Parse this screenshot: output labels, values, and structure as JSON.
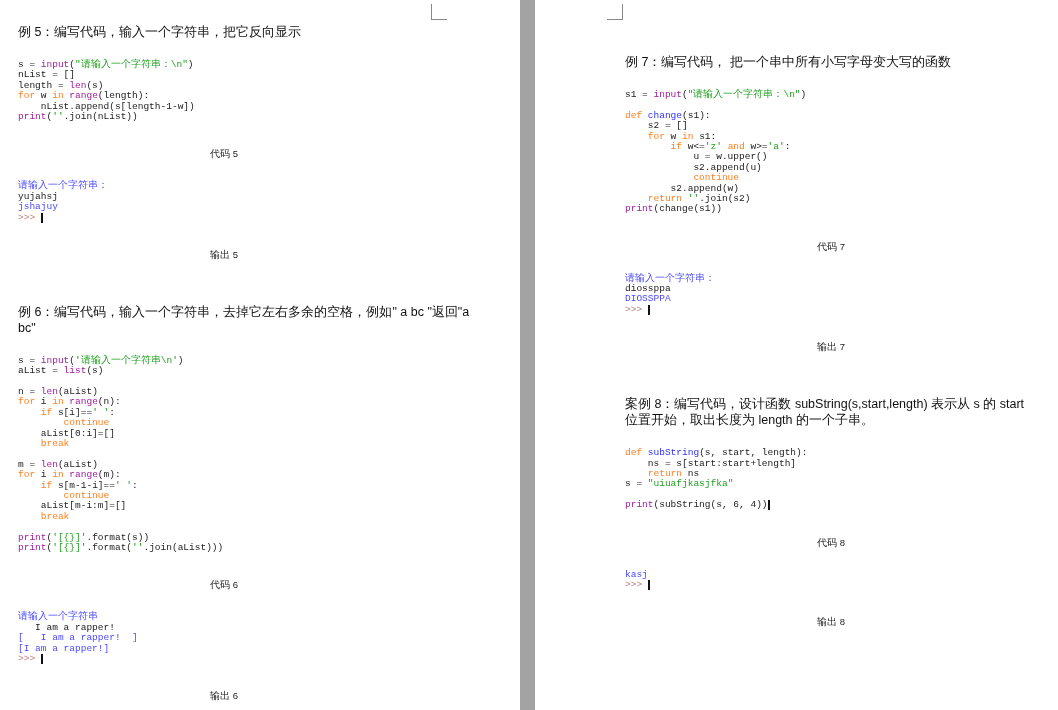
{
  "pages": [
    {
      "sections": [
        {
          "heading": "例 5：编写代码，输入一个字符串，把它反向显示",
          "code": [
            {
              "kind": "text",
              "tokens": [
                {
                  "kind": "plain",
                  "text": "s = "
                },
                {
                  "kind": "builtin",
                  "text": "input"
                },
                {
                  "kind": "plain",
                  "text": "("
                },
                {
                  "kind": "string",
                  "text": "\"请输入一个字符串：\\n\""
                },
                {
                  "kind": "plain",
                  "text": ")"
                }
              ]
            },
            {
              "kind": "text",
              "tokens": [
                {
                  "kind": "plain",
                  "text": "nList = []"
                }
              ]
            },
            {
              "kind": "text",
              "tokens": [
                {
                  "kind": "plain",
                  "text": "length = "
                },
                {
                  "kind": "builtin",
                  "text": "len"
                },
                {
                  "kind": "plain",
                  "text": "(s)"
                }
              ]
            },
            {
              "kind": "text",
              "tokens": [
                {
                  "kind": "keyword",
                  "text": "for"
                },
                {
                  "kind": "plain",
                  "text": " w "
                },
                {
                  "kind": "keyword",
                  "text": "in "
                },
                {
                  "kind": "builtin",
                  "text": "range"
                },
                {
                  "kind": "plain",
                  "text": "(length):"
                }
              ]
            },
            {
              "kind": "text",
              "tokens": [
                {
                  "kind": "plain",
                  "text": "    nList.append(s[length-1-w])"
                }
              ]
            },
            {
              "kind": "text",
              "tokens": [
                {
                  "kind": "builtin",
                  "text": "print"
                },
                {
                  "kind": "plain",
                  "text": "("
                },
                {
                  "kind": "string",
                  "text": "''"
                },
                {
                  "kind": "plain",
                  "text": ".join(nList))"
                }
              ]
            }
          ],
          "code_caption": "代码 5",
          "output": [
            {
              "kind": "text",
              "tokens": [
                {
                  "kind": "output",
                  "text": "请输入一个字符串："
                }
              ]
            },
            {
              "kind": "text",
              "tokens": [
                {
                  "kind": "plain",
                  "text": "yujahsj"
                }
              ]
            },
            {
              "kind": "text",
              "tokens": [
                {
                  "kind": "output",
                  "text": "jshajuy"
                }
              ]
            },
            {
              "kind": "text",
              "tokens": [
                {
                  "kind": "prompt",
                  "text": ">>> "
                }
              ],
              "cursor": true
            }
          ],
          "output_caption": "输出 5"
        },
        {
          "heading": "例 6：编写代码，输入一个字符串，去掉它左右多余的空格，例如\" a bc \"返回\"a bc\"",
          "code": [
            {
              "kind": "text",
              "tokens": [
                {
                  "kind": "plain",
                  "text": "s = "
                },
                {
                  "kind": "builtin",
                  "text": "input"
                },
                {
                  "kind": "plain",
                  "text": "("
                },
                {
                  "kind": "string",
                  "text": "'请输入一个字符串\\n'"
                },
                {
                  "kind": "plain",
                  "text": ")"
                }
              ]
            },
            {
              "kind": "text",
              "tokens": [
                {
                  "kind": "plain",
                  "text": "aList = "
                },
                {
                  "kind": "builtin",
                  "text": "list"
                },
                {
                  "kind": "plain",
                  "text": "(s)"
                }
              ]
            },
            {
              "kind": "blank"
            },
            {
              "kind": "text",
              "tokens": [
                {
                  "kind": "plain",
                  "text": "n = "
                },
                {
                  "kind": "builtin",
                  "text": "len"
                },
                {
                  "kind": "plain",
                  "text": "(aList)"
                }
              ]
            },
            {
              "kind": "text",
              "tokens": [
                {
                  "kind": "keyword",
                  "text": "for"
                },
                {
                  "kind": "plain",
                  "text": " i "
                },
                {
                  "kind": "keyword",
                  "text": "in "
                },
                {
                  "kind": "builtin",
                  "text": "range"
                },
                {
                  "kind": "plain",
                  "text": "(n):"
                }
              ]
            },
            {
              "kind": "text",
              "tokens": [
                {
                  "kind": "keyword",
                  "text": "    if"
                },
                {
                  "kind": "plain",
                  "text": " s[i]=="
                },
                {
                  "kind": "string",
                  "text": "' '"
                },
                {
                  "kind": "plain",
                  "text": ":"
                }
              ]
            },
            {
              "kind": "text",
              "tokens": [
                {
                  "kind": "keyword",
                  "text": "        continue"
                }
              ]
            },
            {
              "kind": "text",
              "tokens": [
                {
                  "kind": "plain",
                  "text": "    aList[0:i]=[]"
                }
              ]
            },
            {
              "kind": "text",
              "tokens": [
                {
                  "kind": "keyword",
                  "text": "    break"
                }
              ]
            },
            {
              "kind": "blank"
            },
            {
              "kind": "text",
              "tokens": [
                {
                  "kind": "plain",
                  "text": "m = "
                },
                {
                  "kind": "builtin",
                  "text": "len"
                },
                {
                  "kind": "plain",
                  "text": "(aList)"
                }
              ]
            },
            {
              "kind": "text",
              "tokens": [
                {
                  "kind": "keyword",
                  "text": "for"
                },
                {
                  "kind": "plain",
                  "text": " i "
                },
                {
                  "kind": "keyword",
                  "text": "in "
                },
                {
                  "kind": "builtin",
                  "text": "range"
                },
                {
                  "kind": "plain",
                  "text": "(m):"
                }
              ]
            },
            {
              "kind": "text",
              "tokens": [
                {
                  "kind": "keyword",
                  "text": "    if"
                },
                {
                  "kind": "plain",
                  "text": " s[m-1-i]=="
                },
                {
                  "kind": "string",
                  "text": "' '"
                },
                {
                  "kind": "plain",
                  "text": ":"
                }
              ]
            },
            {
              "kind": "text",
              "tokens": [
                {
                  "kind": "keyword",
                  "text": "        continue"
                }
              ]
            },
            {
              "kind": "text",
              "tokens": [
                {
                  "kind": "plain",
                  "text": "    aList[m-i:m]=[]"
                }
              ]
            },
            {
              "kind": "text",
              "tokens": [
                {
                  "kind": "keyword",
                  "text": "    break"
                }
              ]
            },
            {
              "kind": "blank"
            },
            {
              "kind": "text",
              "tokens": [
                {
                  "kind": "builtin",
                  "text": "print"
                },
                {
                  "kind": "plain",
                  "text": "("
                },
                {
                  "kind": "string",
                  "text": "'[{}]'"
                },
                {
                  "kind": "plain",
                  "text": ".format(s))"
                }
              ]
            },
            {
              "kind": "text",
              "tokens": [
                {
                  "kind": "builtin",
                  "text": "print"
                },
                {
                  "kind": "plain",
                  "text": "("
                },
                {
                  "kind": "string",
                  "text": "'[{}]'"
                },
                {
                  "kind": "plain",
                  "text": ".format("
                },
                {
                  "kind": "string",
                  "text": "''"
                },
                {
                  "kind": "plain",
                  "text": ".join(aList)))"
                }
              ]
            }
          ],
          "code_caption": "代码 6",
          "output": [
            {
              "kind": "text",
              "tokens": [
                {
                  "kind": "output",
                  "text": "请输入一个字符串"
                }
              ]
            },
            {
              "kind": "text",
              "tokens": [
                {
                  "kind": "plain",
                  "text": "   I am a rapper!"
                }
              ]
            },
            {
              "kind": "text",
              "tokens": [
                {
                  "kind": "output",
                  "text": "[   I am a rapper!  ]"
                }
              ]
            },
            {
              "kind": "text",
              "tokens": [
                {
                  "kind": "output",
                  "text": "[I am a rapper!]"
                }
              ]
            },
            {
              "kind": "text",
              "tokens": [
                {
                  "kind": "prompt",
                  "text": ">>> "
                }
              ],
              "cursor": true
            }
          ],
          "output_caption": "输出 6"
        }
      ]
    },
    {
      "sections": [
        {
          "heading": "例 7：编写代码， 把一个串中所有小写字母变大写的函数",
          "code": [
            {
              "kind": "text",
              "tokens": [
                {
                  "kind": "plain",
                  "text": "s1 = "
                },
                {
                  "kind": "builtin",
                  "text": "input"
                },
                {
                  "kind": "plain",
                  "text": "("
                },
                {
                  "kind": "string",
                  "text": "\"请输入一个字符串：\\n\""
                },
                {
                  "kind": "plain",
                  "text": ")"
                }
              ]
            },
            {
              "kind": "blank"
            },
            {
              "kind": "text",
              "tokens": [
                {
                  "kind": "keyword",
                  "text": "def "
                },
                {
                  "kind": "defname",
                  "text": "change"
                },
                {
                  "kind": "plain",
                  "text": "(s1):"
                }
              ]
            },
            {
              "kind": "text",
              "tokens": [
                {
                  "kind": "plain",
                  "text": "    s2 = []"
                }
              ]
            },
            {
              "kind": "text",
              "tokens": [
                {
                  "kind": "keyword",
                  "text": "    for"
                },
                {
                  "kind": "plain",
                  "text": " w "
                },
                {
                  "kind": "keyword",
                  "text": "in"
                },
                {
                  "kind": "plain",
                  "text": " s1:"
                }
              ]
            },
            {
              "kind": "text",
              "tokens": [
                {
                  "kind": "keyword",
                  "text": "        if"
                },
                {
                  "kind": "plain",
                  "text": " w<="
                },
                {
                  "kind": "string",
                  "text": "'z'"
                },
                {
                  "kind": "keyword",
                  "text": " and"
                },
                {
                  "kind": "plain",
                  "text": " w>="
                },
                {
                  "kind": "string",
                  "text": "'a'"
                },
                {
                  "kind": "plain",
                  "text": ":"
                }
              ]
            },
            {
              "kind": "text",
              "tokens": [
                {
                  "kind": "plain",
                  "text": "            u = w.upper()"
                }
              ]
            },
            {
              "kind": "text",
              "tokens": [
                {
                  "kind": "plain",
                  "text": "            s2.append(u)"
                }
              ]
            },
            {
              "kind": "text",
              "tokens": [
                {
                  "kind": "keyword",
                  "text": "            continue"
                }
              ]
            },
            {
              "kind": "text",
              "tokens": [
                {
                  "kind": "plain",
                  "text": "        s2.append(w)"
                }
              ]
            },
            {
              "kind": "text",
              "tokens": [
                {
                  "kind": "keyword",
                  "text": "    return"
                },
                {
                  "kind": "string",
                  "text": " ''"
                },
                {
                  "kind": "plain",
                  "text": ".join(s2)"
                }
              ]
            },
            {
              "kind": "text",
              "tokens": [
                {
                  "kind": "builtin",
                  "text": "print"
                },
                {
                  "kind": "plain",
                  "text": "(change(s1))"
                }
              ]
            }
          ],
          "code_caption": "代码 7",
          "output": [
            {
              "kind": "text",
              "tokens": [
                {
                  "kind": "output",
                  "text": "请输入一个字符串："
                }
              ]
            },
            {
              "kind": "text",
              "tokens": [
                {
                  "kind": "plain",
                  "text": "diossppa"
                }
              ]
            },
            {
              "kind": "text",
              "tokens": [
                {
                  "kind": "output",
                  "text": "DIOSSPPA"
                }
              ]
            },
            {
              "kind": "text",
              "tokens": [
                {
                  "kind": "prompt",
                  "text": ">>> "
                }
              ],
              "cursor": true
            }
          ],
          "output_caption": "输出 7"
        },
        {
          "heading": "案例 8：编写代码，设计函数 subString(s,start,length) 表示从 s 的 start 位置开始，取出长度为 length 的一个子串。",
          "code": [
            {
              "kind": "text",
              "tokens": [
                {
                  "kind": "keyword",
                  "text": "def "
                },
                {
                  "kind": "defname",
                  "text": "subString"
                },
                {
                  "kind": "plain",
                  "text": "(s, start, length):"
                }
              ]
            },
            {
              "kind": "text",
              "tokens": [
                {
                  "kind": "plain",
                  "text": "    ns = s[start:start+length]"
                }
              ]
            },
            {
              "kind": "text",
              "tokens": [
                {
                  "kind": "keyword",
                  "text": "    return"
                },
                {
                  "kind": "plain",
                  "text": " ns"
                }
              ]
            },
            {
              "kind": "text",
              "tokens": [
                {
                  "kind": "plain",
                  "text": "s = "
                },
                {
                  "kind": "string",
                  "text": "\"uiuafjkasjfka\""
                }
              ]
            },
            {
              "kind": "blank"
            },
            {
              "kind": "text",
              "tokens": [
                {
                  "kind": "builtin",
                  "text": "print"
                },
                {
                  "kind": "plain",
                  "text": "(subString(s, 6, 4))"
                }
              ],
              "cursor": true
            }
          ],
          "code_caption": "代码 8",
          "output": [
            {
              "kind": "text",
              "tokens": [
                {
                  "kind": "output",
                  "text": "kasj"
                }
              ]
            },
            {
              "kind": "text",
              "tokens": [
                {
                  "kind": "prompt",
                  "text": ">>> "
                }
              ],
              "cursor": true
            }
          ],
          "output_caption": "输出 8"
        }
      ]
    }
  ]
}
